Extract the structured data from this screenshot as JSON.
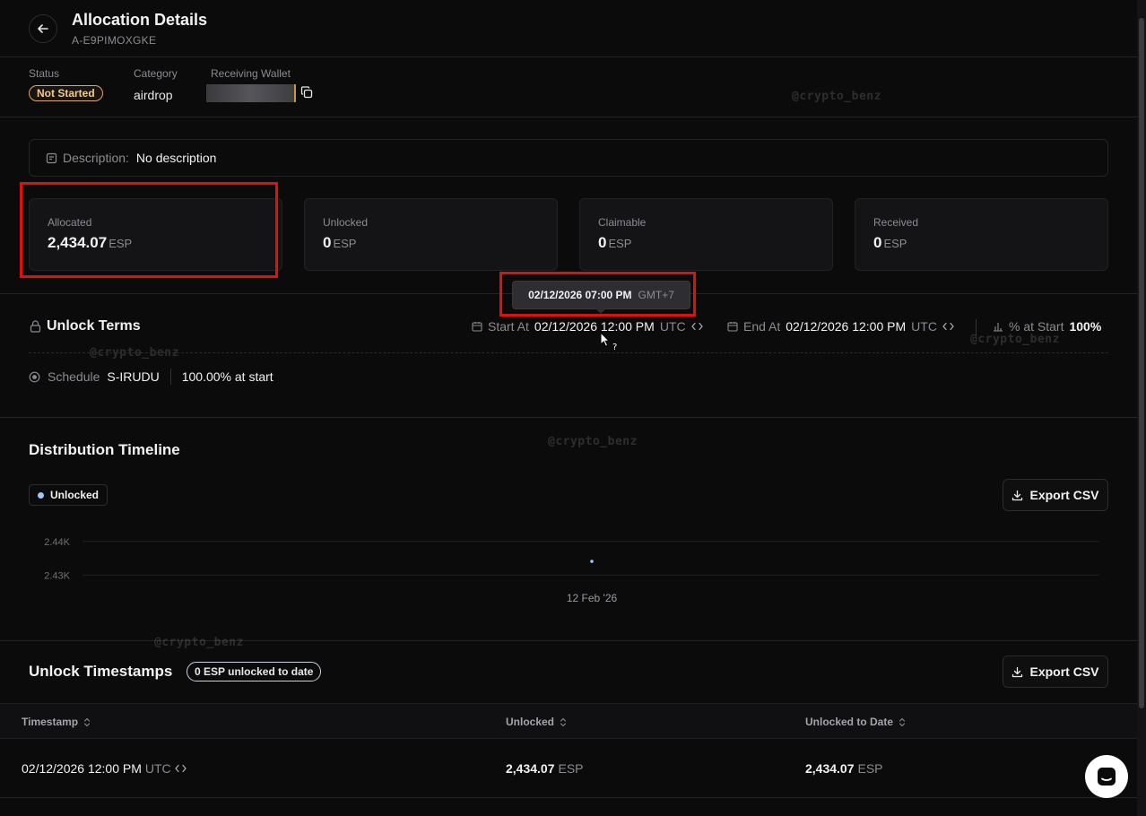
{
  "header": {
    "title": "Allocation Details",
    "id": "A-E9PIMOXGKE"
  },
  "meta": {
    "status_label": "Status",
    "status_value": "Not Started",
    "category_label": "Category",
    "category_value": "airdrop",
    "wallet_label": "Receiving Wallet"
  },
  "watermark": "@crypto_benz",
  "description": {
    "label": "Description:",
    "value": "No description"
  },
  "cards": [
    {
      "label": "Allocated",
      "value": "2,434.07",
      "unit": "ESP"
    },
    {
      "label": "Unlocked",
      "value": "0",
      "unit": "ESP"
    },
    {
      "label": "Claimable",
      "value": "0",
      "unit": "ESP"
    },
    {
      "label": "Received",
      "value": "0",
      "unit": "ESP"
    }
  ],
  "tooltip": {
    "datetime": "02/12/2026 07:00 PM",
    "tz": "GMT+7"
  },
  "unlock_terms": {
    "title": "Unlock Terms",
    "start_label": "Start At",
    "start_value": "02/12/2026 12:00 PM",
    "start_tz": "UTC",
    "end_label": "End At",
    "end_value": "02/12/2026 12:00 PM",
    "end_tz": "UTC",
    "pct_label": "% at Start",
    "pct_value": "100%",
    "schedule_label": "Schedule",
    "schedule_id": "S-IRUDU",
    "schedule_desc": "100.00% at start"
  },
  "timeline": {
    "title": "Distribution Timeline",
    "legend": "Unlocked",
    "export_label": "Export CSV"
  },
  "chart_data": {
    "type": "scatter",
    "series": [
      {
        "name": "Unlocked",
        "x": [
          "12 Feb '26"
        ],
        "y": [
          2434.07
        ]
      }
    ],
    "x_tick_labels": [
      "12 Feb '26"
    ],
    "y_tick_labels": [
      "2.44K",
      "2.43K"
    ],
    "y_ticks": [
      2440,
      2430
    ],
    "ylim": [
      2425,
      2445
    ],
    "grid": true,
    "legend": "top-left"
  },
  "timestamps": {
    "title": "Unlock Timestamps",
    "badge": "0 ESP unlocked to date",
    "export_label": "Export CSV",
    "columns": [
      "Timestamp",
      "Unlocked",
      "Unlocked to Date"
    ],
    "rows": [
      {
        "timestamp": "02/12/2026 12:00 PM",
        "tz": "UTC",
        "unlocked": "2,434.07",
        "unlocked_unit": "ESP",
        "to_date": "2,434.07",
        "to_date_unit": "ESP"
      }
    ]
  },
  "colors": {
    "background": "#0b0b0c",
    "status_badge": "#d9a86a",
    "highlight": "#e01010",
    "series": "#9ec5ff"
  }
}
